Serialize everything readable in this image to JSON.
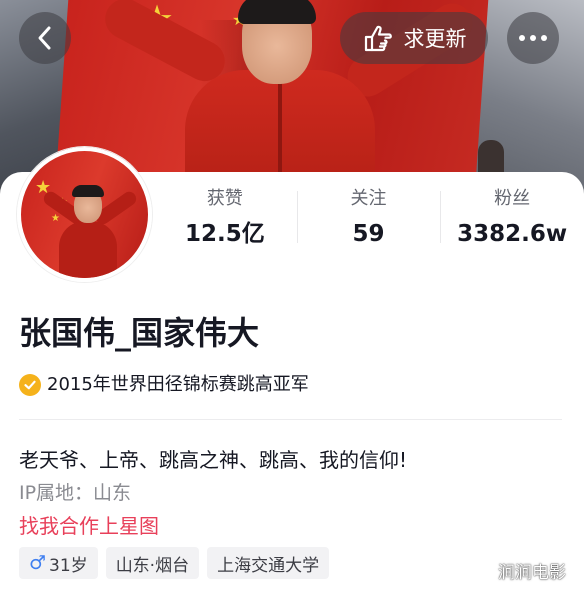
{
  "header": {
    "request_update_label": "求更新",
    "back_icon": "chevron-left-icon",
    "more_icon": "more-dots-icon",
    "request_update_icon": "hand-point-icon"
  },
  "profile": {
    "nickname": "张国伟_国家伟大",
    "verification": "2015年世界田径锦标赛跳高亚军",
    "bio": "老天爷、上帝、跳高之神、跳高、我的信仰!",
    "ip_location": "IP属地：山东",
    "collab_link": "找我合作上星图",
    "tags": [
      {
        "label": "31岁",
        "icon": "male-icon"
      },
      {
        "label": "山东·烟台"
      },
      {
        "label": "上海交通大学"
      }
    ]
  },
  "stats": [
    {
      "label": "获赞",
      "value": "12.5亿"
    },
    {
      "label": "关注",
      "value": "59"
    },
    {
      "label": "粉丝",
      "value": "3382.6w"
    }
  ],
  "colors": {
    "link": "#e8405a",
    "verify_badge": "#f5b21b",
    "gender_icon": "#3f7ff0"
  },
  "watermark": "涧涧电影"
}
